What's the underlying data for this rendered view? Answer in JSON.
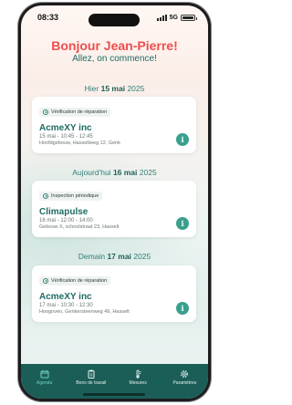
{
  "status": {
    "time": "08:33",
    "network": "5G"
  },
  "header": {
    "greeting": "Bonjour Jean-Pierre!",
    "subtitle": "Allez, on commence!"
  },
  "days": [
    {
      "prefix": "Hier",
      "date": "15 mai",
      "year": "2025",
      "card": {
        "type": "Vérification de réparation",
        "client": "AcmeXY inc",
        "time": "15 mai - 10:45 - 12:45",
        "address": "Hoofdgebouw, Hasseltweg 12, Genk"
      }
    },
    {
      "prefix": "Aujourd'hui",
      "date": "16 mai",
      "year": "2025",
      "card": {
        "type": "Inspection périodique",
        "client": "Climapulse",
        "time": "16 mai - 12:00 - 14:00",
        "address": "Gebouw X, schoolstraat 23, Hasselt"
      }
    },
    {
      "prefix": "Demain",
      "date": "17 mai",
      "year": "2025",
      "card": {
        "type": "Vérification de réparation",
        "client": "AcmeXY inc",
        "time": "17 mai - 10:30 - 12:30",
        "address": "Hoogoven, Genkersteenweg 49, Hasselt"
      }
    }
  ],
  "tabs": [
    {
      "label": "Agenda",
      "icon": "calendar-icon",
      "active": true
    },
    {
      "label": "Bons de travail",
      "icon": "clipboard-icon",
      "active": false
    },
    {
      "label": "Mesures",
      "icon": "thermometer-icon",
      "active": false
    },
    {
      "label": "Paramètres",
      "icon": "gear-icon",
      "active": false
    }
  ],
  "colors": {
    "accent": "#ef4d4d",
    "primary": "#1b5e57",
    "teal": "#3aa08d"
  }
}
